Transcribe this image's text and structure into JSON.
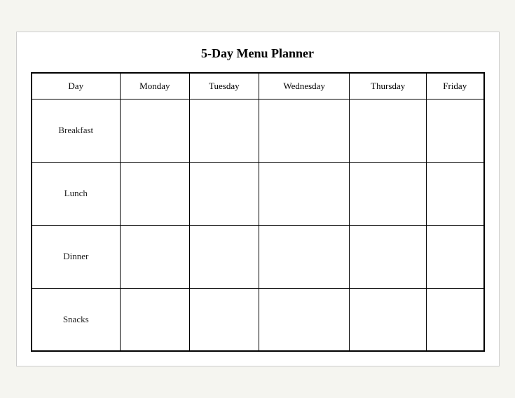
{
  "title": "5-Day Menu Planner",
  "columns": {
    "col0": "Day",
    "col1": "Monday",
    "col2": "Tuesday",
    "col3": "Wednesday",
    "col4": "Thursday",
    "col5": "Friday"
  },
  "rows": [
    {
      "label": "Breakfast"
    },
    {
      "label": "Lunch"
    },
    {
      "label": "Dinner"
    },
    {
      "label": "Snacks"
    }
  ]
}
